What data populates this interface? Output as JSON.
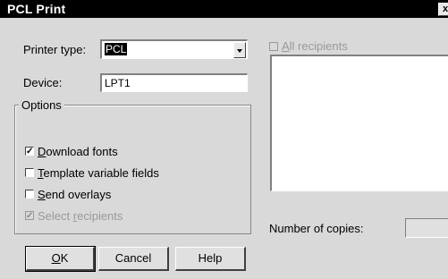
{
  "window": {
    "title": "PCL Print",
    "close_glyph": "x"
  },
  "printer_type": {
    "label": "Printer type:",
    "value": "PCL"
  },
  "device": {
    "label": "Device:",
    "value": "LPT1"
  },
  "options": {
    "legend": "Options",
    "items": [
      {
        "label_u": "D",
        "label_rest": "ownload fonts",
        "checked": true,
        "enabled": true
      },
      {
        "label_u": "T",
        "label_rest": "emplate variable fields",
        "checked": false,
        "enabled": true
      },
      {
        "label_u": "S",
        "label_rest": "end overlays",
        "checked": false,
        "enabled": true
      },
      {
        "label_pre": "Select ",
        "label_u": "r",
        "label_rest": "ecipients",
        "checked": true,
        "enabled": false
      }
    ]
  },
  "recipients": {
    "all_u": "A",
    "all_rest": "ll recipients",
    "checked": false,
    "enabled": false
  },
  "copies": {
    "label": "Number of copies:",
    "value": ""
  },
  "buttons": {
    "ok_u": "O",
    "ok_rest": "K",
    "cancel": "Cancel",
    "help": "Help"
  },
  "colors": {
    "titlebar": "#000000",
    "dialog_bg": "#d9d9d9",
    "disabled_text": "#999999"
  },
  "check_glyph": "✓"
}
